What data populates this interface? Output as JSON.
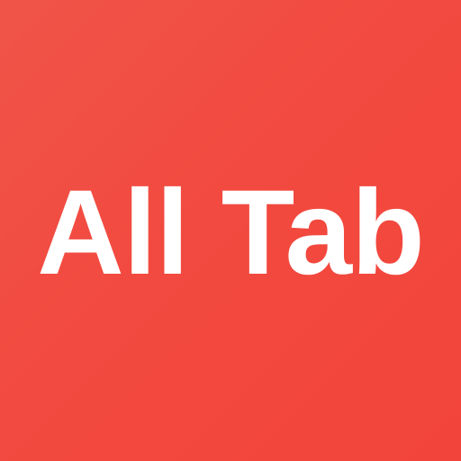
{
  "app": {
    "title": "All Tab",
    "colors": {
      "background": "#f24a40",
      "text": "#ffffff"
    }
  }
}
